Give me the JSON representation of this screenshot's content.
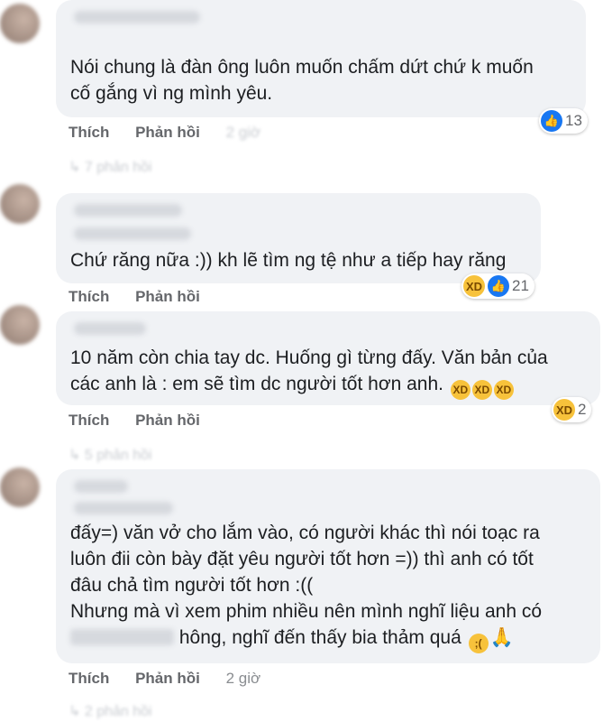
{
  "comments": [
    {
      "lines": [
        "Nói chung là đàn ông luôn muốn chấm dứt chứ k muốn",
        "cố gắng vì ng mình yêu."
      ],
      "reaction_count": "13",
      "reaction_types": [
        "like"
      ],
      "like_label": "Thích",
      "reply_label": "Phản hồi",
      "time": "2 giờ",
      "replies_text": "7 phản hồi"
    },
    {
      "lines": [
        "Chứ răng nữa :)) kh lẽ tìm ng tệ như a tiếp hay răng"
      ],
      "reaction_count": "21",
      "reaction_types": [
        "haha",
        "like"
      ],
      "like_label": "Thích",
      "reply_label": "Phản hồi"
    },
    {
      "lines": [
        "10 năm còn chia tay dc. Huống gì từng đấy. Văn bản của",
        "các anh là : em sẽ tìm dc người tốt hơn anh."
      ],
      "reaction_count": "2",
      "reaction_types": [
        "haha"
      ],
      "like_label": "Thích",
      "reply_label": "Phản hồi",
      "replies_text": "5 phản hồi"
    },
    {
      "lines": [
        "đấy=) văn vở cho lắm vào, có người khác thì nói toạc ra",
        "luôn đii còn bày đặt yêu người tốt hơn =)) thì anh có tốt",
        "đâu chả tìm người tốt hơn :((",
        "Nhưng mà vì xem phim nhiều nên mình nghĩ liệu anh có",
        "hông, nghĩ đến thấy bia thảm quá"
      ],
      "like_label": "Thích",
      "reply_label": "Phản hồi",
      "time": "2 giờ",
      "replies_text": "2 phản hồi"
    }
  ]
}
